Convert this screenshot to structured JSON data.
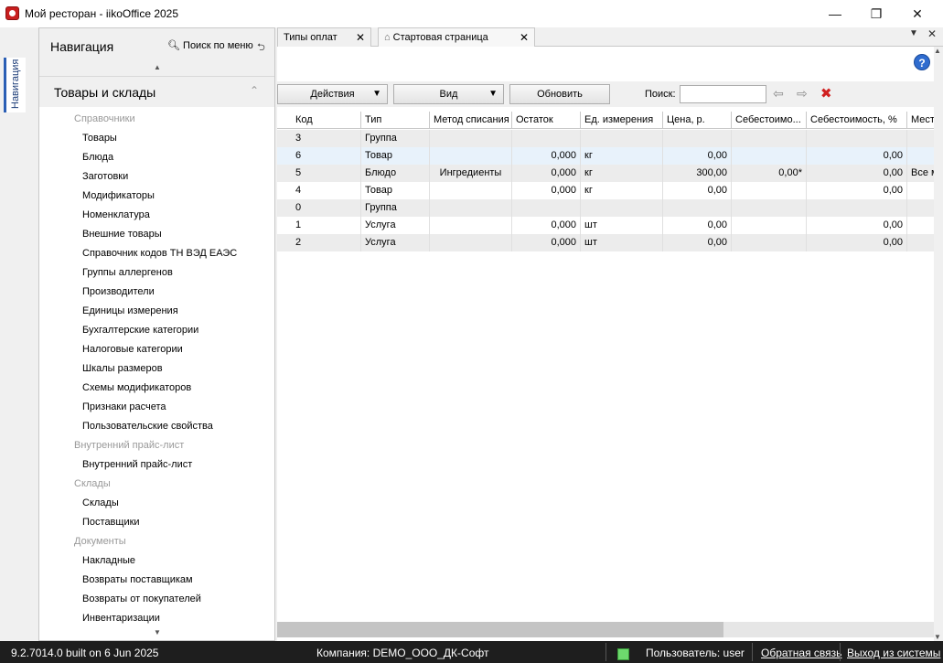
{
  "window": {
    "title": "Мой ресторан - iikoOffice 2025",
    "minimize": "—",
    "maximize": "❐",
    "close": "✕"
  },
  "side_tab": {
    "label": "Навигация"
  },
  "navigation": {
    "title": "Навигация",
    "search_label": "Поиск по меню",
    "section_title": "Товары и склады",
    "items": [
      {
        "type": "group",
        "label": "Справочники"
      },
      {
        "type": "item",
        "label": "Товары"
      },
      {
        "type": "item",
        "label": "Блюда"
      },
      {
        "type": "item",
        "label": "Заготовки"
      },
      {
        "type": "item",
        "label": "Модификаторы"
      },
      {
        "type": "item",
        "label": "Номенклатура"
      },
      {
        "type": "item",
        "label": "Внешние товары"
      },
      {
        "type": "item",
        "label": "Справочник кодов ТН ВЭД ЕАЭС"
      },
      {
        "type": "item",
        "label": "Группы аллергенов"
      },
      {
        "type": "item",
        "label": "Производители"
      },
      {
        "type": "item",
        "label": "Единицы измерения"
      },
      {
        "type": "item",
        "label": "Бухгалтерские категории"
      },
      {
        "type": "item",
        "label": "Налоговые категории"
      },
      {
        "type": "item",
        "label": "Шкалы размеров"
      },
      {
        "type": "item",
        "label": "Схемы модификаторов"
      },
      {
        "type": "item",
        "label": "Признаки расчета"
      },
      {
        "type": "item",
        "label": "Пользовательские свойства"
      },
      {
        "type": "group",
        "label": "Внутренний прайс-лист"
      },
      {
        "type": "item",
        "label": "Внутренний прайс-лист"
      },
      {
        "type": "group",
        "label": "Склады"
      },
      {
        "type": "item",
        "label": "Склады"
      },
      {
        "type": "item",
        "label": "Поставщики"
      },
      {
        "type": "group",
        "label": "Документы"
      },
      {
        "type": "item",
        "label": "Накладные"
      },
      {
        "type": "item",
        "label": "Возвраты поставщикам"
      },
      {
        "type": "item",
        "label": "Возвраты от покупателей"
      },
      {
        "type": "item",
        "label": "Инвентаризации"
      }
    ]
  },
  "tabs": [
    {
      "label": "Типы оплат",
      "close": "✕"
    },
    {
      "label": "Стартовая страница",
      "close": "✕"
    }
  ],
  "toolbar": {
    "actions_label": "Действия",
    "view_label": "Вид",
    "refresh_label": "Обновить",
    "search_label": "Поиск:",
    "search_value": ""
  },
  "grid": {
    "columns": [
      "Код",
      "Тип",
      "Метод списания",
      "Остаток",
      "Ед. измерения",
      "Цена, р.",
      "Себестоимо...",
      "Себестоимость, %",
      "Мест"
    ],
    "rows": [
      [
        "3",
        "Группа",
        "",
        "",
        "",
        "",
        "",
        "",
        ""
      ],
      [
        "6",
        "Товар",
        "",
        "0,000",
        "кг",
        "0,00",
        "",
        "0,00",
        ""
      ],
      [
        "5",
        "Блюдо",
        "Ингредиенты",
        "0,000",
        "кг",
        "300,00",
        "0,00*",
        "0,00",
        "Все м"
      ],
      [
        "4",
        "Товар",
        "",
        "0,000",
        "кг",
        "0,00",
        "",
        "0,00",
        ""
      ],
      [
        "0",
        "Группа",
        "",
        "",
        "",
        "",
        "",
        "",
        ""
      ],
      [
        "1",
        "Услуга",
        "",
        "0,000",
        "шт",
        "0,00",
        "",
        "0,00",
        ""
      ],
      [
        "2",
        "Услуга",
        "",
        "0,000",
        "шт",
        "0,00",
        "",
        "0,00",
        ""
      ]
    ]
  },
  "status_bar": {
    "version": "9.2.7014.0 built on 6 Jun 2025",
    "company": "Компания: DEMO_ООО_ДК-Софт",
    "user": "Пользователь: user",
    "feedback": "Обратная связь",
    "logout": "Выход из системы"
  },
  "colors": {
    "accent": "#2b5fb5",
    "status_online": "#6dd96d",
    "delete_red": "#d02020"
  }
}
